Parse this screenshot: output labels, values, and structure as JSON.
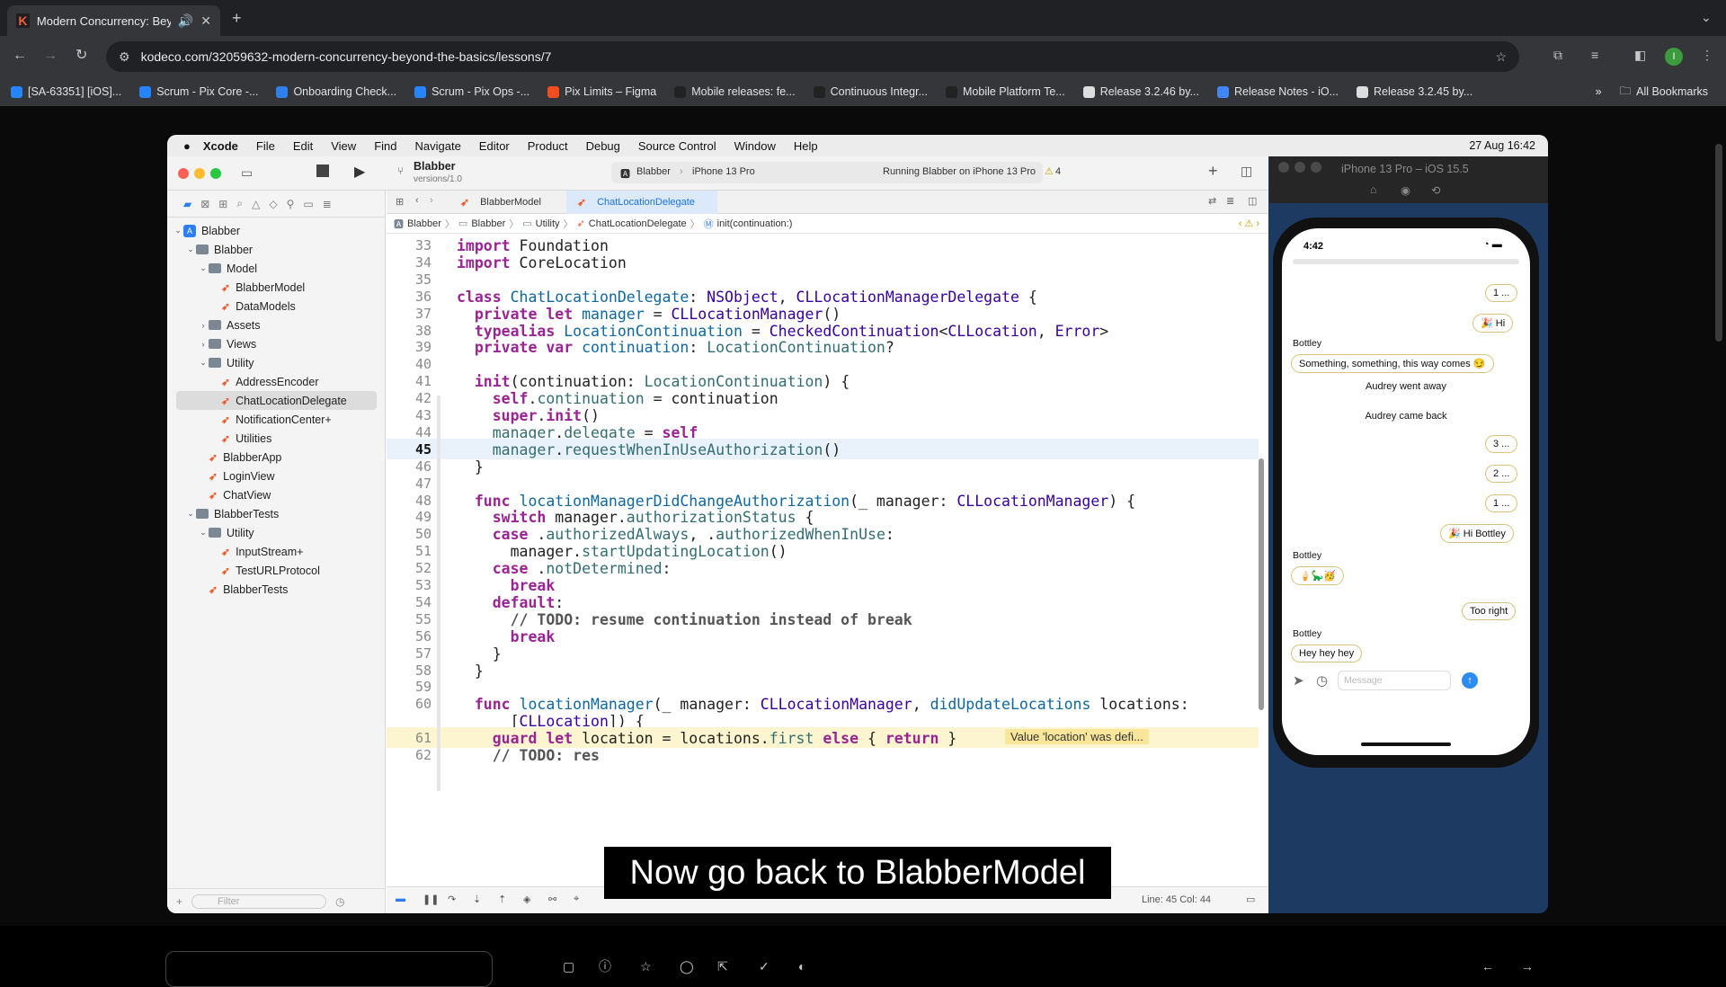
{
  "browser": {
    "tab_title": "Modern Concurrency: Bey",
    "url": "kodeco.com/32059632-modern-concurrency-beyond-the-basics/lessons/7",
    "bookmarks": [
      {
        "label": "[SA-63351] [iOS]...",
        "color": "#2684ff"
      },
      {
        "label": "Scrum - Pix Core -...",
        "color": "#2684ff"
      },
      {
        "label": "Onboarding Check...",
        "color": "#2f80ed"
      },
      {
        "label": "Scrum - Pix Ops -...",
        "color": "#2684ff"
      },
      {
        "label": "Pix Limits – Figma",
        "color": "#f24e1e"
      },
      {
        "label": "Mobile releases: fe...",
        "color": "#222"
      },
      {
        "label": "Continuous Integr...",
        "color": "#222"
      },
      {
        "label": "Mobile Platform Te...",
        "color": "#222"
      },
      {
        "label": "Release 3.2.46 by...",
        "color": "#ddd"
      },
      {
        "label": "Release Notes - iO...",
        "color": "#4285f4"
      },
      {
        "label": "Release 3.2.45 by...",
        "color": "#ddd"
      }
    ],
    "all_bookmarks": "All Bookmarks"
  },
  "mac_menu": {
    "app": "Xcode",
    "items": [
      "File",
      "Edit",
      "View",
      "Find",
      "Navigate",
      "Editor",
      "Product",
      "Debug",
      "Source Control",
      "Window",
      "Help"
    ],
    "datetime": "27 Aug  16:42"
  },
  "xcode": {
    "project": "Blabber",
    "branch": "versions/1.0",
    "scheme": "Blabber",
    "device": "iPhone 13 Pro",
    "status": "Running Blabber on iPhone 13 Pro",
    "warnings": "4",
    "tabs": [
      "BlabberModel",
      "ChatLocationDelegate"
    ],
    "jumpbar": [
      "Blabber",
      "Blabber",
      "Utility",
      "ChatLocationDelegate",
      "init(continuation:)"
    ],
    "filter_placeholder": "Filter",
    "cursor": "Line: 45  Col: 44",
    "tree": [
      {
        "label": "Blabber",
        "indent": 0,
        "kind": "project",
        "chev": "v"
      },
      {
        "label": "Blabber",
        "indent": 1,
        "kind": "folder",
        "chev": "v"
      },
      {
        "label": "Model",
        "indent": 2,
        "kind": "folder",
        "chev": "v"
      },
      {
        "label": "BlabberModel",
        "indent": 3,
        "kind": "swift",
        "chev": ""
      },
      {
        "label": "DataModels",
        "indent": 3,
        "kind": "swift",
        "chev": ""
      },
      {
        "label": "Assets",
        "indent": 2,
        "kind": "folder",
        "chev": ">"
      },
      {
        "label": "Views",
        "indent": 2,
        "kind": "folder",
        "chev": ">"
      },
      {
        "label": "Utility",
        "indent": 2,
        "kind": "folder",
        "chev": "v"
      },
      {
        "label": "AddressEncoder",
        "indent": 3,
        "kind": "swift",
        "chev": ""
      },
      {
        "label": "ChatLocationDelegate",
        "indent": 3,
        "kind": "swift",
        "chev": "",
        "selected": true
      },
      {
        "label": "NotificationCenter+",
        "indent": 3,
        "kind": "swift",
        "chev": ""
      },
      {
        "label": "Utilities",
        "indent": 3,
        "kind": "swift",
        "chev": ""
      },
      {
        "label": "BlabberApp",
        "indent": 2,
        "kind": "swift",
        "chev": ""
      },
      {
        "label": "LoginView",
        "indent": 2,
        "kind": "swift",
        "chev": ""
      },
      {
        "label": "ChatView",
        "indent": 2,
        "kind": "swift",
        "chev": ""
      },
      {
        "label": "BlabberTests",
        "indent": 1,
        "kind": "folder",
        "chev": "v"
      },
      {
        "label": "Utility",
        "indent": 2,
        "kind": "folder",
        "chev": "v"
      },
      {
        "label": "InputStream+",
        "indent": 3,
        "kind": "swift",
        "chev": ""
      },
      {
        "label": "TestURLProtocol",
        "indent": 3,
        "kind": "swift",
        "chev": ""
      },
      {
        "label": "BlabberTests",
        "indent": 2,
        "kind": "swift",
        "chev": ""
      }
    ],
    "code": [
      {
        "n": "33",
        "html": "<span class=\"kw\">import</span> Foundation"
      },
      {
        "n": "34",
        "html": "<span class=\"kw\">import</span> CoreLocation"
      },
      {
        "n": "35",
        "html": ""
      },
      {
        "n": "36",
        "html": "<span class=\"kw\">class</span> <span class=\"fn\">ChatLocationDelegate</span>: <span class=\"ty\">NSObject</span>, <span class=\"ty\">CLLocationManagerDelegate</span> {"
      },
      {
        "n": "37",
        "html": "  <span class=\"kw\">private let</span> <span class=\"fn\">manager</span> = <span class=\"ty\">CLLocationManager</span>()"
      },
      {
        "n": "38",
        "html": "  <span class=\"kw\">typealias</span> <span class=\"fn\">LocationContinuation</span> = <span class=\"ty\">CheckedContinuation</span>&lt;<span class=\"ty\">CLLocation</span>, <span class=\"ty\">Error</span>&gt;"
      },
      {
        "n": "39",
        "html": "  <span class=\"kw\">private var</span> <span class=\"fn\">continuation</span>: <span class=\"pr\">LocationContinuation</span>?"
      },
      {
        "n": "40",
        "html": ""
      },
      {
        "n": "41",
        "html": "  <span class=\"kw\">init</span>(continuation: <span class=\"pr\">LocationContinuation</span>) {"
      },
      {
        "n": "42",
        "html": "    <span class=\"kw\">self</span>.<span class=\"pr\">continuation</span> = continuation"
      },
      {
        "n": "43",
        "html": "    <span class=\"kw\">super</span>.<span class=\"kw\">init</span>()"
      },
      {
        "n": "44",
        "html": "    <span class=\"pr\">manager</span>.<span class=\"pr\">delegate</span> = <span class=\"kw\">self</span>"
      },
      {
        "n": "45",
        "html": "    <span class=\"pr\">manager</span>.<span class=\"pr\">requestWhenInUseAuthorization</span>()"
      },
      {
        "n": "46",
        "html": "  }"
      },
      {
        "n": "47",
        "html": ""
      },
      {
        "n": "48",
        "html": "  <span class=\"kw\">func</span> <span class=\"fn\">locationManagerDidChangeAuthorization</span>(_ manager: <span class=\"ty\">CLLocationManager</span>) {"
      },
      {
        "n": "49",
        "html": "    <span class=\"kw\">switch</span> manager.<span class=\"pr\">authorizationStatus</span> {"
      },
      {
        "n": "50",
        "html": "    <span class=\"kw\">case</span> .<span class=\"pr\">authorizedAlways</span>, .<span class=\"pr\">authorizedWhenInUse</span>:"
      },
      {
        "n": "51",
        "html": "      manager.<span class=\"pr\">startUpdatingLocation</span>()"
      },
      {
        "n": "52",
        "html": "    <span class=\"kw\">case</span> .<span class=\"pr\">notDetermined</span>:"
      },
      {
        "n": "53",
        "html": "      <span class=\"kw\">break</span>"
      },
      {
        "n": "54",
        "html": "    <span class=\"kw\">default</span>:"
      },
      {
        "n": "55",
        "html": "      <span class=\"cm\">// TODO: resume continuation instead of break</span>"
      },
      {
        "n": "56",
        "html": "      <span class=\"kw\">break</span>"
      },
      {
        "n": "57",
        "html": "    }"
      },
      {
        "n": "58",
        "html": "  }"
      },
      {
        "n": "59",
        "html": ""
      },
      {
        "n": "60",
        "html": "  <span class=\"kw\">func</span> <span class=\"fn\">locationManager</span>(_ manager: <span class=\"ty\">CLLocationManager</span>, <span class=\"fn\">didUpdateLocations</span> locations:"
      },
      {
        "n": "",
        "html": "      [<span class=\"ty\">CLLocation</span>]) {"
      },
      {
        "n": "61",
        "html": "    <span class=\"kw\">guard let</span> location = locations.<span class=\"pr\">first</span> <span class=\"kw\">else</span> { <span class=\"kw\">return</span> }"
      },
      {
        "n": "62",
        "html": "    <span class=\"cm\">// TODO: res</span>"
      }
    ],
    "warning_text": "Value 'location' was defi..."
  },
  "caption": "Now go back to BlabberModel",
  "simulator": {
    "title": "iPhone 13 Pro – iOS 15.5",
    "time": "4:42",
    "message_placeholder": "Message",
    "chat": {
      "b1": "1 ...",
      "b2": "🎉 Hi",
      "who1": "Bottley",
      "b3": "Something, something, this way comes 😏",
      "sys1": "Audrey went away",
      "sys2": "Audrey came back",
      "b4": "3 ...",
      "b5": "2 ...",
      "b6": "1 ...",
      "b7": "🎉 Hi Bottley",
      "who2": "Bottley",
      "b8": "🍦🦕🥳",
      "b9": "Too right",
      "who3": "Bottley",
      "b10": "Hey hey hey"
    }
  }
}
